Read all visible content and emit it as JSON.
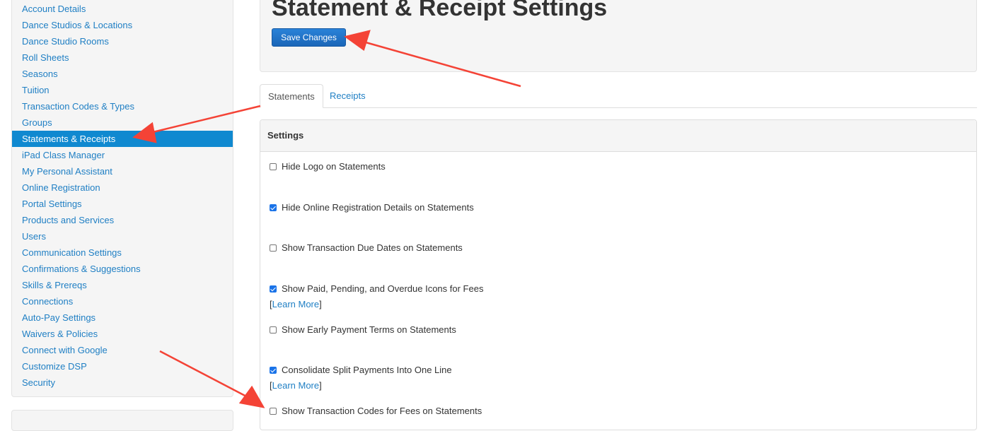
{
  "sidebar": {
    "items": [
      {
        "label": "Account Details",
        "active": false
      },
      {
        "label": "Dance Studios & Locations",
        "active": false
      },
      {
        "label": "Dance Studio Rooms",
        "active": false
      },
      {
        "label": "Roll Sheets",
        "active": false
      },
      {
        "label": "Seasons",
        "active": false
      },
      {
        "label": "Tuition",
        "active": false
      },
      {
        "label": "Transaction Codes & Types",
        "active": false
      },
      {
        "label": "Groups",
        "active": false
      },
      {
        "label": "Statements & Receipts",
        "active": true
      },
      {
        "label": "iPad Class Manager",
        "active": false
      },
      {
        "label": "My Personal Assistant",
        "active": false
      },
      {
        "label": "Online Registration",
        "active": false
      },
      {
        "label": "Portal Settings",
        "active": false
      },
      {
        "label": "Products and Services",
        "active": false
      },
      {
        "label": "Users",
        "active": false
      },
      {
        "label": "Communication Settings",
        "active": false
      },
      {
        "label": "Confirmations & Suggestions",
        "active": false
      },
      {
        "label": "Skills & Prereqs",
        "active": false
      },
      {
        "label": "Connections",
        "active": false
      },
      {
        "label": "Auto-Pay Settings",
        "active": false
      },
      {
        "label": "Waivers & Policies",
        "active": false
      },
      {
        "label": "Connect with Google",
        "active": false
      },
      {
        "label": "Customize DSP",
        "active": false
      },
      {
        "label": "Security",
        "active": false
      }
    ]
  },
  "header": {
    "title": "Statement & Receipt Settings",
    "save_label": "Save Changes"
  },
  "tabs": {
    "statements": "Statements",
    "receipts": "Receipts"
  },
  "settings": {
    "heading": "Settings",
    "learn_more": "Learn More",
    "options": [
      {
        "label": "Hide Logo on Statements",
        "checked": false
      },
      {
        "label": "Hide Online Registration Details on Statements",
        "checked": true
      },
      {
        "label": "Show Transaction Due Dates on Statements",
        "checked": false
      },
      {
        "label": "Show Paid, Pending, and Overdue Icons for Fees",
        "checked": true
      },
      {
        "label": "Show Early Payment Terms on Statements",
        "checked": false
      },
      {
        "label": "Consolidate Split Payments Into One Line",
        "checked": true
      },
      {
        "label": "Show Transaction Codes for Fees on Statements",
        "checked": false
      }
    ]
  },
  "colors": {
    "link": "#1f7fc4",
    "active_bg": "#1089d0",
    "button": "#1a66b8",
    "annotation_arrow": "#f44336"
  }
}
